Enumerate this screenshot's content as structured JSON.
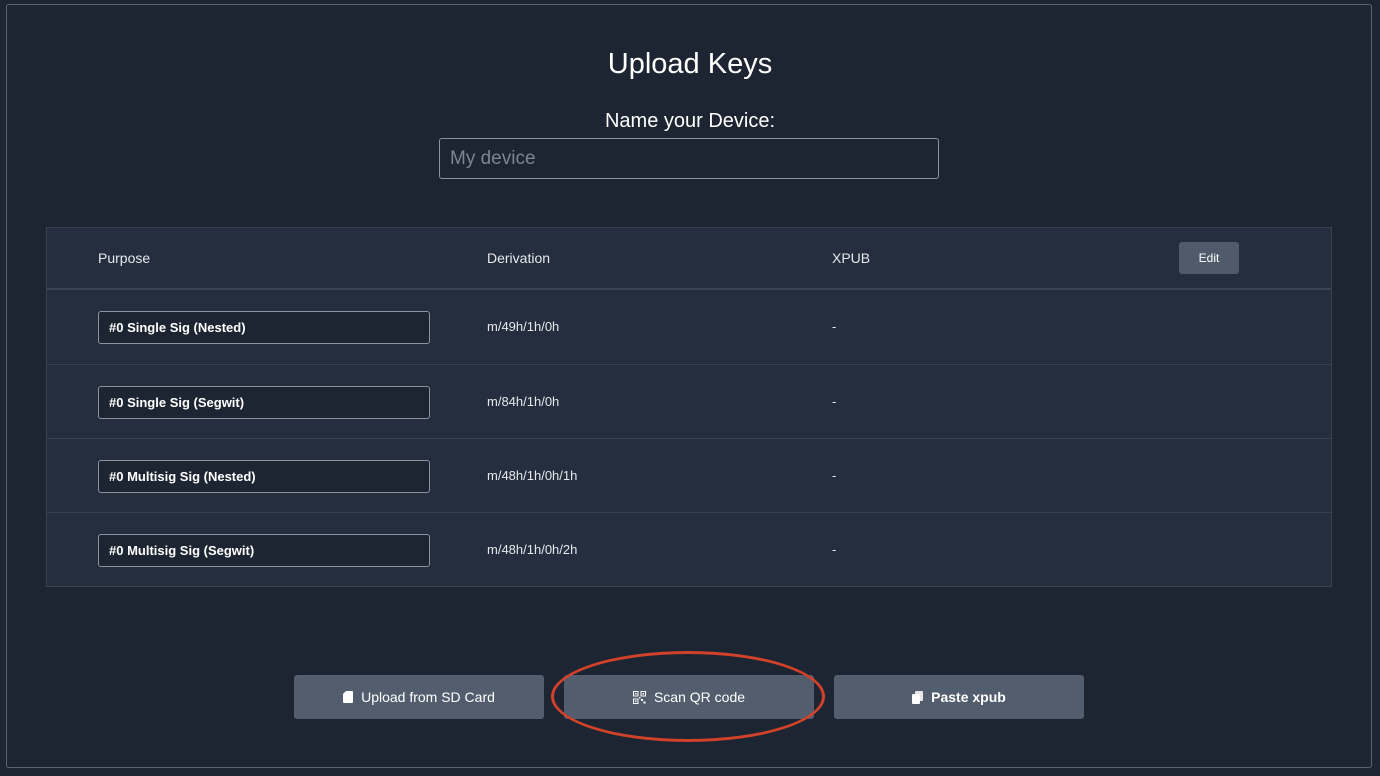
{
  "page": {
    "title": "Upload Keys",
    "name_label": "Name your Device:",
    "name_placeholder": "My device",
    "name_value": ""
  },
  "table": {
    "headers": {
      "purpose": "Purpose",
      "derivation": "Derivation",
      "xpub": "XPUB"
    },
    "edit_label": "Edit",
    "rows": [
      {
        "purpose": "#0 Single Sig (Nested)",
        "derivation": "m/49h/1h/0h",
        "xpub": "-"
      },
      {
        "purpose": "#0 Single Sig (Segwit)",
        "derivation": "m/84h/1h/0h",
        "xpub": "-"
      },
      {
        "purpose": "#0 Multisig Sig (Nested)",
        "derivation": "m/48h/1h/0h/1h",
        "xpub": "-"
      },
      {
        "purpose": "#0 Multisig Sig (Segwit)",
        "derivation": "m/48h/1h/0h/2h",
        "xpub": "-"
      }
    ]
  },
  "actions": {
    "upload_sd": {
      "label": "Upload from SD Card",
      "icon": "sd-card-icon"
    },
    "scan_qr": {
      "label": "Scan QR code",
      "icon": "qr-code-icon"
    },
    "paste_xpub": {
      "label": "Paste xpub",
      "icon": "clipboard-icon"
    }
  },
  "colors": {
    "background": "#1c2531",
    "table": "#252e3e",
    "button": "#525e6e",
    "highlight": "#d2412a"
  }
}
